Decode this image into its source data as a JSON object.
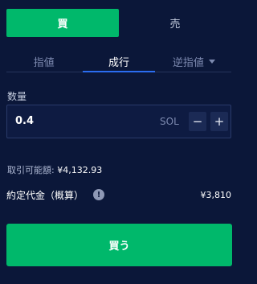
{
  "side_toggle": {
    "buy_label": "買",
    "sell_label": "売",
    "selected": "buy"
  },
  "order_tabs": [
    {
      "label": "指値",
      "active": false,
      "has_dropdown": false
    },
    {
      "label": "成行",
      "active": true,
      "has_dropdown": false
    },
    {
      "label": "逆指値",
      "active": false,
      "has_dropdown": true
    }
  ],
  "quantity": {
    "label": "数量",
    "value": "0.4",
    "unit": "SOL",
    "minus": "−",
    "plus": "+"
  },
  "available": {
    "label": "取引可能額:",
    "value": "¥4,132.93"
  },
  "estimate": {
    "label": "約定代金（概算）",
    "info_glyph": "!",
    "value": "¥3,810"
  },
  "submit": {
    "label": "買う"
  },
  "colors": {
    "background": "#0b1739",
    "buy_green": "#00b86b",
    "accent_blue": "#2b6df0"
  }
}
